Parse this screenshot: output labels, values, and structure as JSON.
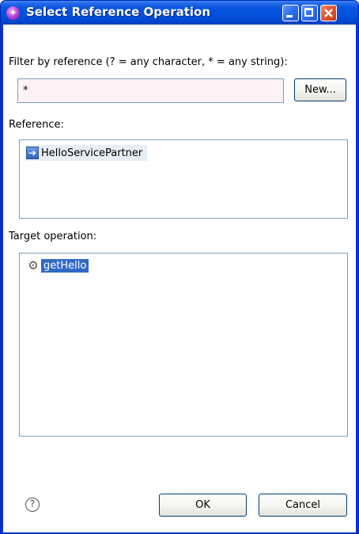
{
  "window": {
    "title": "Select Reference Operation",
    "app_icon_glyph": "✦",
    "controls": {
      "minimize_icon": "minimize-icon",
      "maximize_icon": "maximize-icon",
      "close_icon": "close-icon"
    }
  },
  "filter": {
    "label": "Filter by reference (? = any character, * = any string):",
    "value": "*",
    "new_button_label": "New..."
  },
  "reference": {
    "label": "Reference:",
    "items": [
      {
        "label": "HelloServicePartner",
        "icon": "reference-arrow-icon"
      }
    ]
  },
  "target_operation": {
    "label": "Target operation:",
    "items": [
      {
        "label": "getHello",
        "icon": "operation-gear-icon",
        "selected": true
      }
    ]
  },
  "footer": {
    "help_glyph": "?",
    "ok_label": "OK",
    "cancel_label": "Cancel"
  },
  "colors": {
    "titlebar_blue": "#0a55e0",
    "selection_blue": "#316ac5",
    "input_background": "#fdf2f6",
    "list_border": "#7f9db9"
  }
}
